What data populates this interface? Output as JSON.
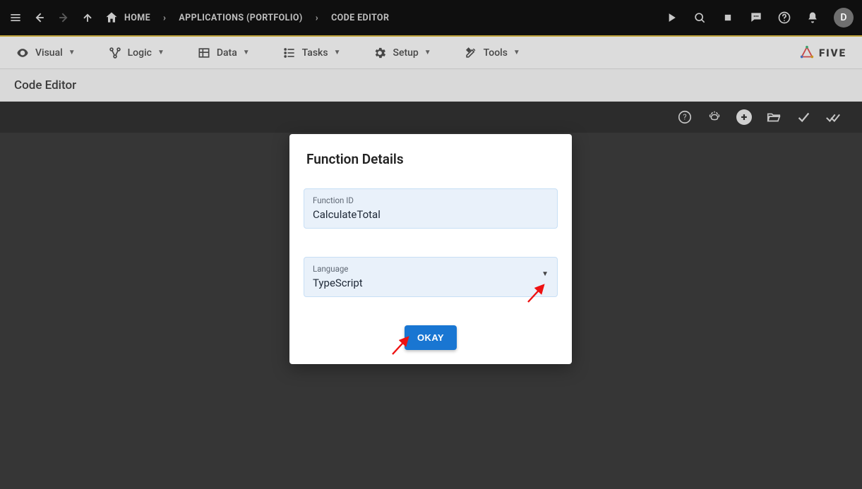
{
  "topbar": {
    "breadcrumbs": [
      {
        "label": "HOME",
        "icon": "home"
      },
      {
        "label": "APPLICATIONS (PORTFOLIO)"
      },
      {
        "label": "CODE EDITOR"
      }
    ],
    "avatar_initial": "D"
  },
  "menubar": {
    "items": [
      {
        "label": "Visual",
        "icon": "eye"
      },
      {
        "label": "Logic",
        "icon": "flow"
      },
      {
        "label": "Data",
        "icon": "table"
      },
      {
        "label": "Tasks",
        "icon": "list"
      },
      {
        "label": "Setup",
        "icon": "gear"
      },
      {
        "label": "Tools",
        "icon": "tools"
      }
    ],
    "brand": "FIVE"
  },
  "subheader": {
    "title": "Code Editor"
  },
  "modal": {
    "title": "Function Details",
    "function_id_label": "Function ID",
    "function_id_value": "CalculateTotal",
    "language_label": "Language",
    "language_value": "TypeScript",
    "okay_label": "OKAY"
  }
}
